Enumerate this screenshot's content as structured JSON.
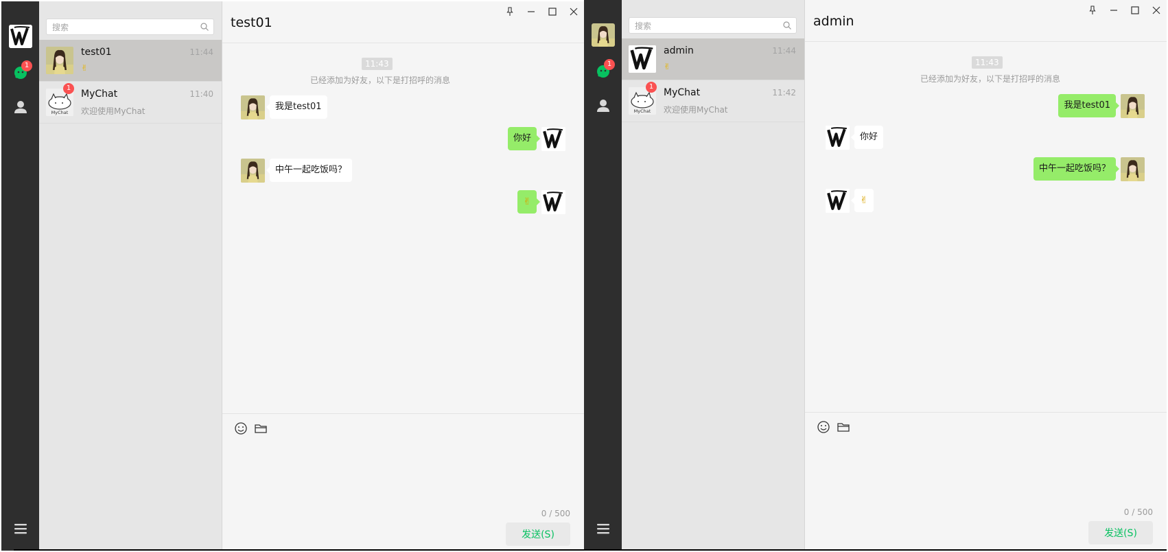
{
  "windows": [
    {
      "title": "test01",
      "unread_chats": "1",
      "search": {
        "placeholder": "搜索"
      },
      "conversations": [
        {
          "name": "test01",
          "time": "11:44",
          "preview": "✌",
          "badge": "",
          "avatar": "girl"
        },
        {
          "name": "MyChat",
          "time": "11:40",
          "preview": "欢迎使用MyChat",
          "badge": "1",
          "avatar": "mychat"
        }
      ],
      "time_divider": "11:43",
      "system_note": "已经添加为好友，以下是打招呼的消息",
      "messages": [
        {
          "dir": "in",
          "text": "我是test01",
          "avatar": "girl"
        },
        {
          "dir": "out",
          "text": "你好",
          "avatar": "w"
        },
        {
          "dir": "in",
          "text": "中午一起吃饭吗？",
          "avatar": "girl"
        },
        {
          "dir": "out",
          "text": "✌",
          "avatar": "w"
        }
      ],
      "counter": "0 / 500",
      "send_label": "发送(S)"
    },
    {
      "title": "admin",
      "unread_chats": "1",
      "search": {
        "placeholder": "搜索"
      },
      "conversations": [
        {
          "name": "admin",
          "time": "11:44",
          "preview": "✌",
          "badge": "",
          "avatar": "w"
        },
        {
          "name": "MyChat",
          "time": "11:42",
          "preview": "欢迎使用MyChat",
          "badge": "1",
          "avatar": "mychat"
        }
      ],
      "time_divider": "11:43",
      "system_note": "已经添加为好友，以下是打招呼的消息",
      "messages": [
        {
          "dir": "out",
          "text": "我是test01",
          "avatar": "girl"
        },
        {
          "dir": "in",
          "text": "你好",
          "avatar": "w"
        },
        {
          "dir": "out",
          "text": "中午一起吃饭吗？",
          "avatar": "girl"
        },
        {
          "dir": "in",
          "text": "✌",
          "avatar": "w"
        }
      ],
      "counter": "0 / 500",
      "send_label": "发送(S)"
    }
  ],
  "colors": {
    "rail": "#2e2e2e",
    "list_bg": "#e6e6e6",
    "selected_conv": "#c9c8c6",
    "chat_bg": "#f5f5f5",
    "outgoing_bubble": "#95ec69",
    "incoming_bubble": "#ffffff",
    "badge": "#fa5151",
    "send_text": "#07c160"
  }
}
